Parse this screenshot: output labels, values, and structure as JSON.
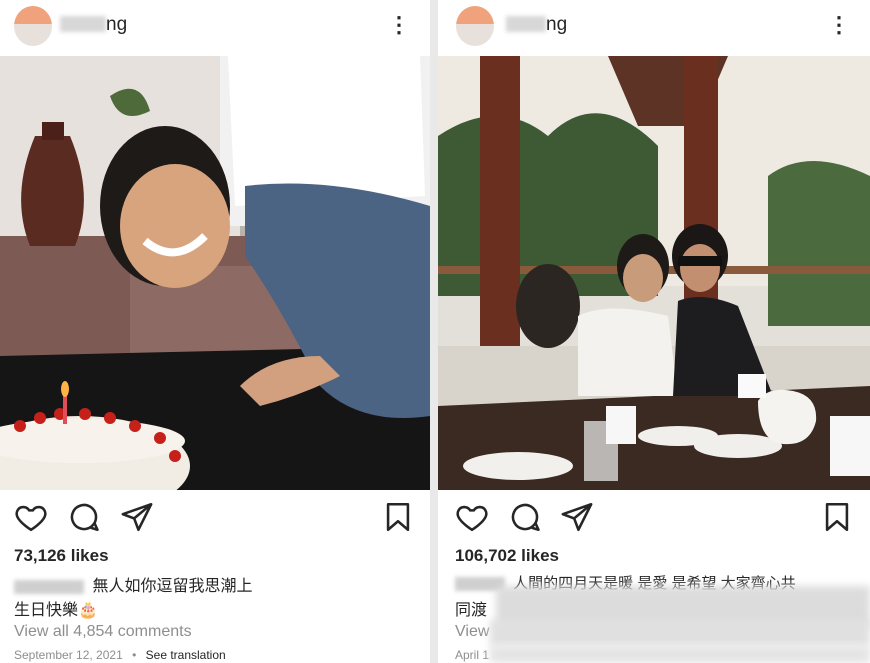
{
  "left_post": {
    "username": "ng",
    "likes": "73,126 likes",
    "caption_line1": "無人如你逗留我思潮上",
    "caption_line2": "生日快樂🎂",
    "comments_link": "View all 4,854 comments",
    "date": "September 12, 2021",
    "translation_link": "See translation"
  },
  "right_post": {
    "username": "ng",
    "likes": "106,702 likes",
    "caption_line1": "人間的四月天是暖 是愛 是希望 大家齊心共",
    "caption_line2": "同渡",
    "comments_link": "View",
    "date": "April 1"
  },
  "icons": {
    "like": "heart-icon",
    "comment": "comment-bubble-icon",
    "share": "paper-plane-icon",
    "save": "bookmark-icon",
    "more": "more-vertical-icon"
  }
}
